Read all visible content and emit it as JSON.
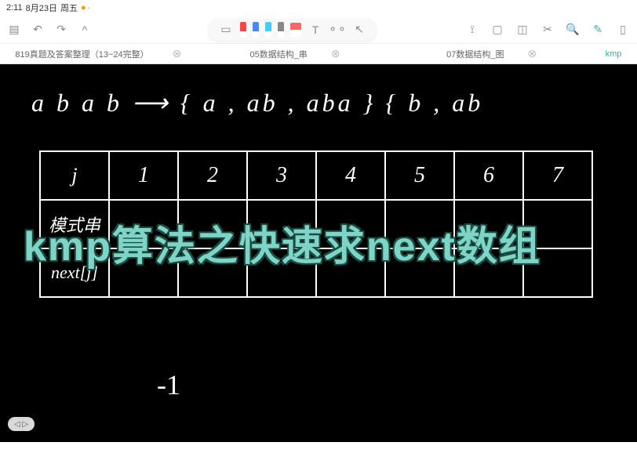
{
  "status_bar": {
    "time": "2:11",
    "date": "8月23日",
    "weekday": "周五"
  },
  "tabs": {
    "t1": "819真题及答案整理（13~24完整）",
    "t2": "05数据结构_串",
    "t3": "07数据结构_图",
    "t4": "kmp"
  },
  "formula": "a  b  a  b  ⟶ { a , ab , aba }   { b , ab",
  "table": {
    "row1": [
      "j",
      "1",
      "2",
      "3",
      "4",
      "5",
      "6",
      "7"
    ],
    "row2_label": "模式串",
    "row3_label": "next[j]"
  },
  "title_overlay": "kmp算法之快速求next数组",
  "below_value": "-1",
  "scroll_hint": "◁ ▷"
}
